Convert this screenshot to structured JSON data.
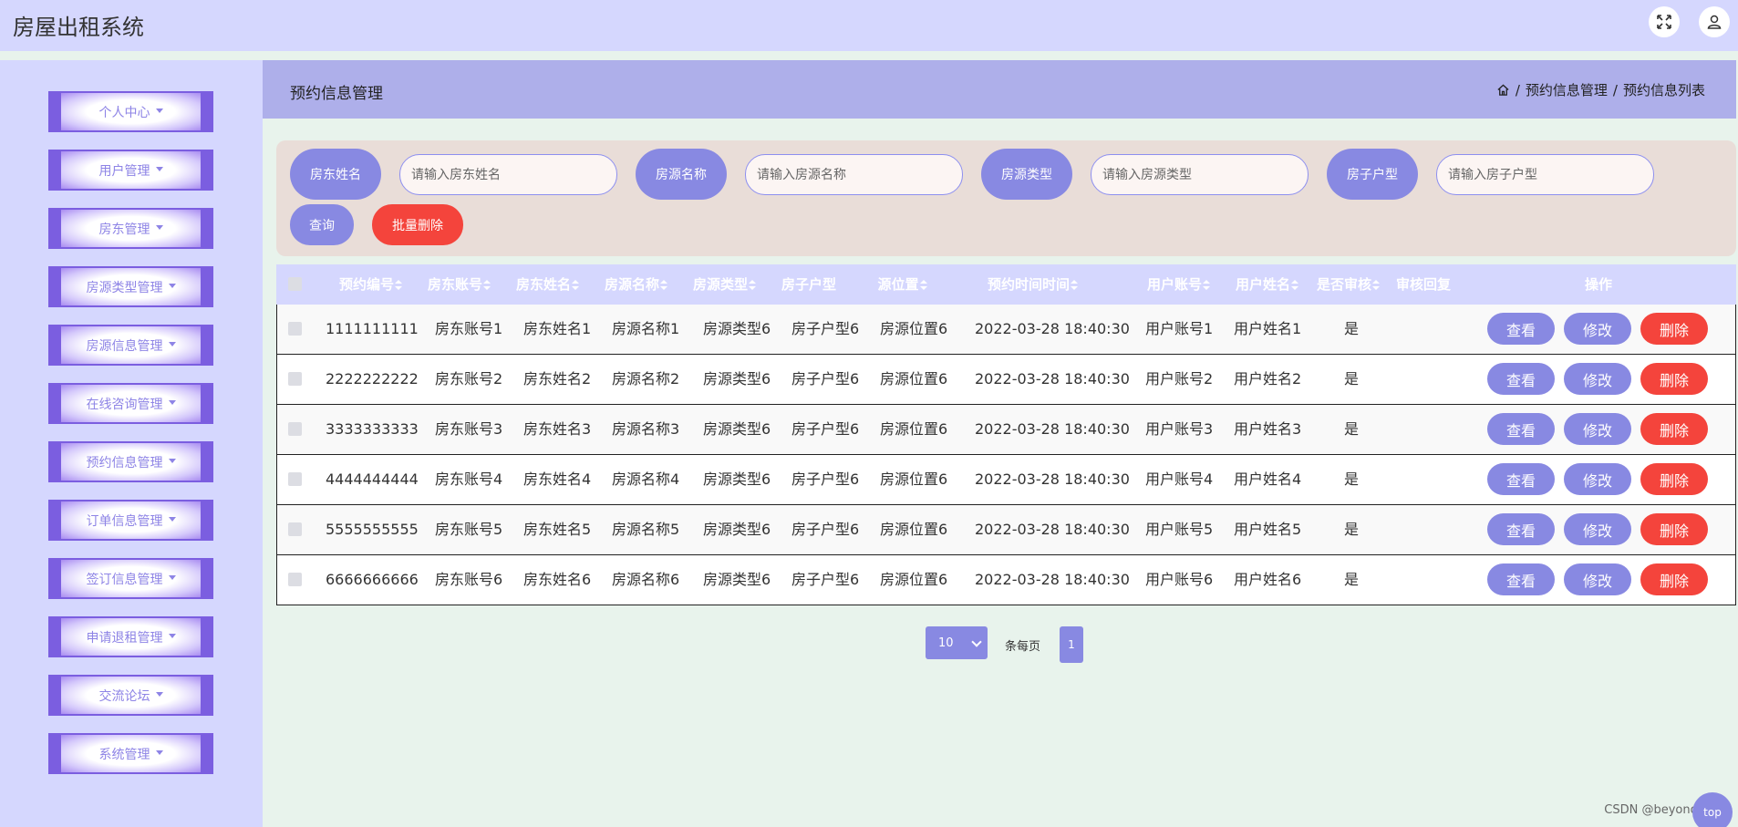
{
  "app": {
    "title": "房屋出租系统"
  },
  "topbar_icons": [
    "fullscreen-icon",
    "user-icon"
  ],
  "sidebar": {
    "items": [
      {
        "label": "个人中心"
      },
      {
        "label": "用户管理"
      },
      {
        "label": "房东管理"
      },
      {
        "label": "房源类型管理"
      },
      {
        "label": "房源信息管理"
      },
      {
        "label": "在线咨询管理"
      },
      {
        "label": "预约信息管理"
      },
      {
        "label": "订单信息管理"
      },
      {
        "label": "签订信息管理"
      },
      {
        "label": "申请退租管理"
      },
      {
        "label": "交流论坛"
      },
      {
        "label": "系统管理"
      }
    ]
  },
  "header": {
    "title": "预约信息管理",
    "breadcrumb": [
      "预约信息管理",
      "预约信息列表"
    ],
    "sep": "/"
  },
  "search": {
    "fields": [
      {
        "label": "房东姓名",
        "placeholder": "请输入房东姓名",
        "value": ""
      },
      {
        "label": "房源名称",
        "placeholder": "请输入房源名称",
        "value": ""
      },
      {
        "label": "房源类型",
        "placeholder": "请输入房源类型",
        "value": ""
      },
      {
        "label": "房子户型",
        "placeholder": "请输入房子户型",
        "value": ""
      }
    ],
    "query_label": "查询",
    "bulk_delete_label": "批量删除"
  },
  "table": {
    "columns": [
      "预约编号",
      "房东账号",
      "房东姓名",
      "房源名称",
      "房源类型",
      "房子户型",
      "源位置",
      "预约时间时间",
      "用户账号",
      "用户姓名",
      "是否审核",
      "审核回复",
      "操作"
    ],
    "rows": [
      {
        "id": "1111111111",
        "landlord_account": "房东账号1",
        "landlord_name": "房东姓名1",
        "house_name": "房源名称1",
        "house_type": "房源类型6",
        "layout": "房子户型6",
        "location": "房源位置6",
        "time": "2022-03-28 18:40:30",
        "user_account": "用户账号1",
        "user_name": "用户姓名1",
        "approved": "是",
        "reply": ""
      },
      {
        "id": "2222222222",
        "landlord_account": "房东账号2",
        "landlord_name": "房东姓名2",
        "house_name": "房源名称2",
        "house_type": "房源类型6",
        "layout": "房子户型6",
        "location": "房源位置6",
        "time": "2022-03-28 18:40:30",
        "user_account": "用户账号2",
        "user_name": "用户姓名2",
        "approved": "是",
        "reply": ""
      },
      {
        "id": "3333333333",
        "landlord_account": "房东账号3",
        "landlord_name": "房东姓名3",
        "house_name": "房源名称3",
        "house_type": "房源类型6",
        "layout": "房子户型6",
        "location": "房源位置6",
        "time": "2022-03-28 18:40:30",
        "user_account": "用户账号3",
        "user_name": "用户姓名3",
        "approved": "是",
        "reply": ""
      },
      {
        "id": "4444444444",
        "landlord_account": "房东账号4",
        "landlord_name": "房东姓名4",
        "house_name": "房源名称4",
        "house_type": "房源类型6",
        "layout": "房子户型6",
        "location": "房源位置6",
        "time": "2022-03-28 18:40:30",
        "user_account": "用户账号4",
        "user_name": "用户姓名4",
        "approved": "是",
        "reply": ""
      },
      {
        "id": "5555555555",
        "landlord_account": "房东账号5",
        "landlord_name": "房东姓名5",
        "house_name": "房源名称5",
        "house_type": "房源类型6",
        "layout": "房子户型6",
        "location": "房源位置6",
        "time": "2022-03-28 18:40:30",
        "user_account": "用户账号5",
        "user_name": "用户姓名5",
        "approved": "是",
        "reply": ""
      },
      {
        "id": "6666666666",
        "landlord_account": "房东账号6",
        "landlord_name": "房东姓名6",
        "house_name": "房源名称6",
        "house_type": "房源类型6",
        "layout": "房子户型6",
        "location": "房源位置6",
        "time": "2022-03-28 18:40:30",
        "user_account": "用户账号6",
        "user_name": "用户姓名6",
        "approved": "是",
        "reply": ""
      }
    ],
    "actions": {
      "view": "查看",
      "edit": "修改",
      "delete": "删除"
    }
  },
  "pagination": {
    "page_size": "10",
    "per_page_label": "条每页",
    "current_page": "1"
  },
  "watermark": "CSDN @beyondwild",
  "fab_label": "top",
  "colors": {
    "accent": "#8889e2",
    "danger": "#f4443c",
    "sidebar_bg": "#d5d7fe",
    "menu_border": "#7b5ee0",
    "header_bg": "#aeafea",
    "search_bg": "#e9ddd8"
  }
}
